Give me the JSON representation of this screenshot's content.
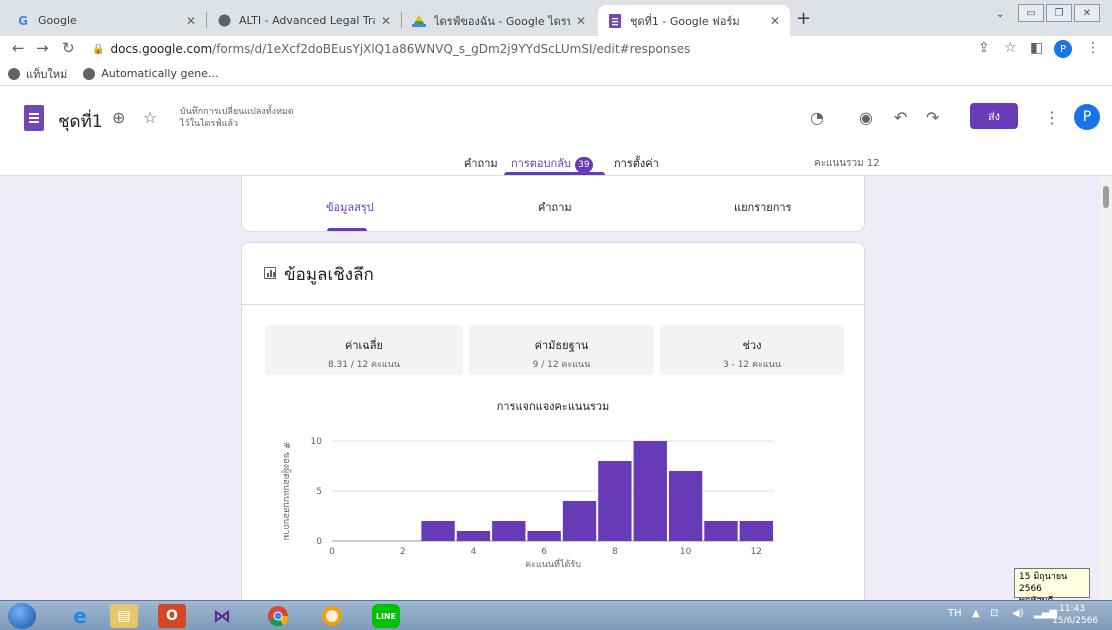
{
  "browser": {
    "tabs": [
      {
        "title": "Google",
        "icon": "google-icon"
      },
      {
        "title": "ALTI - Advanced Legal Training In",
        "icon": "globe-icon"
      },
      {
        "title": "ไดรฟ์ของฉัน - Google ไดรฟ์",
        "icon": "drive-icon"
      },
      {
        "title": "ชุดที่1 - Google ฟอร์ม",
        "icon": "forms-icon"
      }
    ],
    "new_tab": "+",
    "url_host": "docs.google.com",
    "url_path": "/forms/d/1eXcf2doBEusYjXlQ1a86WNVQ_s_gDm2j9YYdScLUmSI/edit#responses",
    "profile_initial": "P",
    "bookmarks": [
      "แท็บใหม่",
      "Automatically gene..."
    ]
  },
  "form": {
    "title": "ชุดที่1",
    "save_status_line1": "บันทึกการเปลี่ยนแปลงทั้งหมด",
    "save_status_line2": "ไว้ในไดรฟ์แล้ว",
    "send_label": "ส่ง",
    "profile_initial": "P",
    "tabs": {
      "questions": "คำถาม",
      "responses": "การตอบกลับ",
      "responses_count": "39",
      "settings": "การตั้งค่า"
    },
    "total_points": "คะแนนรวม 12"
  },
  "summary": {
    "subtabs": [
      "ข้อมูลสรุป",
      "คำถาม",
      "แยกรายการ"
    ],
    "insight_title": "ข้อมูลเชิงลึก",
    "stats": [
      {
        "label": "ค่าเฉลี่ย",
        "value": "8.31 / 12 คะแนน"
      },
      {
        "label": "ค่ามัธยฐาน",
        "value": "9 / 12 คะแนน"
      },
      {
        "label": "ช่วง",
        "value": "3 - 12 คะแนน"
      }
    ]
  },
  "chart_data": {
    "type": "bar",
    "title": "การแจกแจงคะแนนรวม",
    "xlabel": "คะแนนที่ได้รับ",
    "ylabel": "# ของผู้ตอบแบบสอบถาม",
    "categories": [
      3,
      4,
      5,
      6,
      7,
      8,
      9,
      10,
      11,
      12
    ],
    "values": [
      2,
      1,
      2,
      1,
      4,
      8,
      10,
      7,
      2,
      2
    ],
    "x_ticks": [
      0,
      2,
      4,
      6,
      8,
      10,
      12
    ],
    "y_ticks": [
      0,
      5,
      10
    ],
    "xlim": [
      0,
      12.5
    ],
    "ylim": [
      0,
      10
    ],
    "bar_color": "#673ab7",
    "grid": true
  },
  "tooltip": {
    "line1": "15 มิถุนายน 2566",
    "line2": "พฤหัสบดี"
  },
  "taskbar": {
    "language": "TH",
    "time": "11:43",
    "date": "15/6/2566"
  }
}
